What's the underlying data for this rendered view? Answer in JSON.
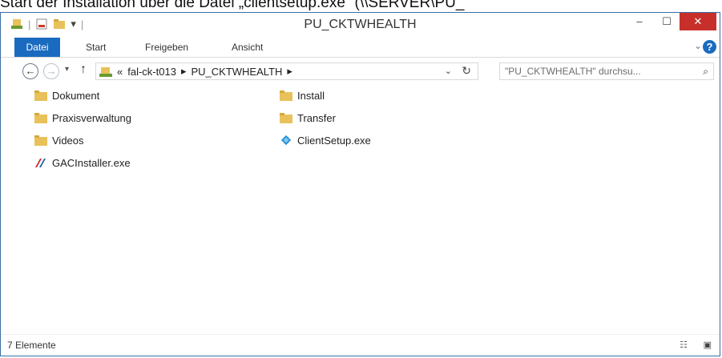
{
  "caption": "Start der Installation über die Datei „clientsetup.exe“ (\\\\SERVER\\PU_",
  "window": {
    "title": "PU_CKTWHEALTH",
    "minimize_symbol": "–",
    "maximize_symbol": "☐",
    "close_symbol": "✕"
  },
  "ribbon": {
    "tabs": [
      "Datei",
      "Start",
      "Freigeben",
      "Ansicht"
    ],
    "expand_symbol": "⌄",
    "help_symbol": "?"
  },
  "nav": {
    "back_symbol": "←",
    "forward_symbol": "→",
    "recent_symbol": "▾",
    "up_symbol": "↑",
    "address_prefix": "«",
    "path": [
      "fal-ck-t013",
      "PU_CKTWHEALTH"
    ],
    "separator": "▸",
    "dropdown_symbol": "⌄",
    "refresh_symbol": "↻",
    "search_placeholder": "\"PU_CKTWHEALTH\" durchsu...",
    "search_symbol": "⌕"
  },
  "files_col1": [
    {
      "name": "Dokument",
      "icon": "folder-icon"
    },
    {
      "name": "Praxisverwaltung",
      "icon": "folder-icon"
    },
    {
      "name": "Videos",
      "icon": "folder-icon"
    },
    {
      "name": "GACInstaller.exe",
      "icon": "installer-icon"
    }
  ],
  "files_col2": [
    {
      "name": "Install",
      "icon": "folder-icon"
    },
    {
      "name": "Transfer",
      "icon": "folder-icon"
    },
    {
      "name": "ClientSetup.exe",
      "icon": "setup-icon"
    }
  ],
  "status": {
    "count": "7 Elemente",
    "details_view_symbol": "☷",
    "large_icons_symbol": "▣"
  },
  "colors": {
    "accent": "#1a6bbf",
    "close": "#c7302a",
    "folder": "#e8c15a"
  }
}
